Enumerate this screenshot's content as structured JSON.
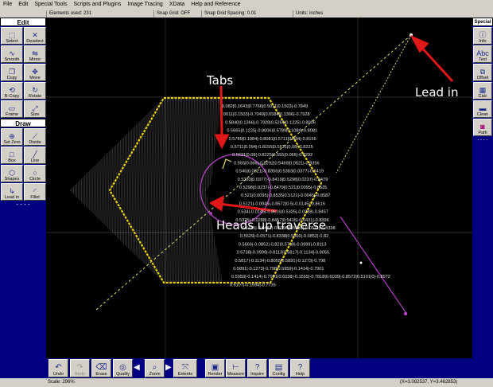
{
  "menu": [
    "File",
    "Edit",
    "Special Tools",
    "Scripts and Plugins",
    "Image Tracing",
    "XData",
    "Help and Reference"
  ],
  "status_top": {
    "elements": "Elements used: 231",
    "snap_grid": "Snap Grid: OFF",
    "snap_spacing": "Snap Grid Spacing: 0.01",
    "units": "Units: inches"
  },
  "edit_panel": {
    "title": "Edit",
    "tools": [
      {
        "label": "Select",
        "icon": "select-icon"
      },
      {
        "label": "Deselect",
        "icon": "deselect-icon"
      },
      {
        "label": "Smooth",
        "icon": "smooth-icon"
      },
      {
        "label": "Mirror",
        "icon": "mirror-icon"
      },
      {
        "label": "Copy",
        "icon": "copy-icon"
      },
      {
        "label": "Move",
        "icon": "move-icon"
      },
      {
        "label": "R-Copy",
        "icon": "rotate-copy-icon"
      },
      {
        "label": "Rotate",
        "icon": "rotate-icon"
      },
      {
        "label": "Frame",
        "icon": "frame-icon"
      },
      {
        "label": "Size",
        "icon": "size-icon"
      }
    ]
  },
  "draw_panel": {
    "title": "Draw",
    "tools": [
      {
        "label": "Set Zero",
        "icon": "set-zero-icon"
      },
      {
        "label": "Divide",
        "icon": "divide-icon"
      },
      {
        "label": "Box",
        "icon": "box-icon"
      },
      {
        "label": "Line",
        "icon": "line-icon"
      },
      {
        "label": "Shapes",
        "icon": "shapes-icon"
      },
      {
        "label": "Circle",
        "icon": "circle-icon"
      },
      {
        "label": "Lead in",
        "icon": "lead-in-icon"
      },
      {
        "label": "Fillet",
        "icon": "fillet-icon"
      }
    ]
  },
  "special_panel": {
    "title": "Special",
    "tools": [
      {
        "label": "Info",
        "icon": "info-icon"
      },
      {
        "label": "Text",
        "icon": "text-icon"
      },
      {
        "label": "Offset",
        "icon": "offset-icon"
      },
      {
        "label": "Calc",
        "icon": "calculator-icon"
      },
      {
        "label": "Clean",
        "icon": "clean-icon"
      },
      {
        "label": "Path",
        "icon": "path-icon"
      }
    ]
  },
  "dashes": "- - - -",
  "bottom_tools": [
    {
      "label": "Undo",
      "icon": "undo-icon"
    },
    {
      "label": "Redo",
      "icon": "redo-icon"
    },
    {
      "label": "Erase",
      "icon": "erase-icon"
    },
    {
      "label": "Quality",
      "icon": "quality-icon"
    },
    {
      "label": "Zoom",
      "icon": "zoom-icon"
    },
    {
      "label": "Extents",
      "icon": "extents-icon"
    },
    {
      "label": "Render",
      "icon": "render-icon"
    },
    {
      "label": "Measure",
      "icon": "measure-icon"
    },
    {
      "label": "Inquire",
      "icon": "inquire-icon"
    },
    {
      "label": "Config",
      "icon": "config-icon"
    },
    {
      "label": "Help",
      "icon": "help-icon"
    }
  ],
  "status_bottom": {
    "scale": "Scale: 296%",
    "coords": "(X=3.082537, Y=3.462853)"
  },
  "annotations": {
    "tabs": "Tabs",
    "lead_in": "Lead in",
    "heads_up": "Heads up traverse"
  },
  "coord_labels": [
    "0.082|0.1643|0.7766|0.5011|0.1503|-0.7849",
    "0011|0.1503|-0.7049|0.6584|0.1366|-0.7928",
    "0.5840|0.1366|-0.7928|0.5265|0.1225|-0.8006",
    "0.5665|0.1225|-0.8006|0.5789|0.1084|-0.8081",
    "0.5789|0.1084|-0.8081|0.5711|0.094|-0.8155",
    "0.5711|0.094|-0.8155|0.5631|0.08|-0.8225",
    "0.5631|0.08|-0.8225|0.555|0.066|-0.8292",
    "0.555|0.066|-0.8292|0.5469|0.0521|-0.8356",
    "0.546|0.0521|-0.8356|0.5383|0.0377|-0.8419",
    "0.5383|0.0377|-0.8419|0.5298|0.0237|-0.8479",
    "0.5298|0.0237|-0.8479|0.521|0.0095|-0.8535",
    "0.521|0.0095|-0.8535|0.5121|-0.0045|-0.8587",
    "0.5121|-0.0045|-0.8572|0.5|-0.0145|-0.8616",
    "0.534|-0.0145|-0.8616|0.5325|-0.0288|-0.8457",
    "0.5325|-0.0288|-0.8457|0.5415|-0.0431|-0.8396",
    "0.5415|-0.0431|-0.8396|0.5555|-0.0571|-0.8338",
    "0.5529|-0.0571|-0.8338|0.5666|-0.0852|-0.82",
    "0.5666|-0.0852|-0.82|0.5738|-0.0999|-0.8113",
    "0.5738|-0.0999|-0.8113|0.5817|-0.1134|-0.8055",
    "0.5817|-0.1134|-0.8055|0.5891|-0.1273|-0.798",
    "0.5891|-0.1273|-0.798|0.5959|-0.1414|-0.7901",
    "0.5959|-0.1414|-0.7901|0.6038|-0.1555|-0.7818|0.6039|-0.8572|0.5101|0|-0.8572",
    "0.6107|-0.1694|-0.7735"
  ]
}
